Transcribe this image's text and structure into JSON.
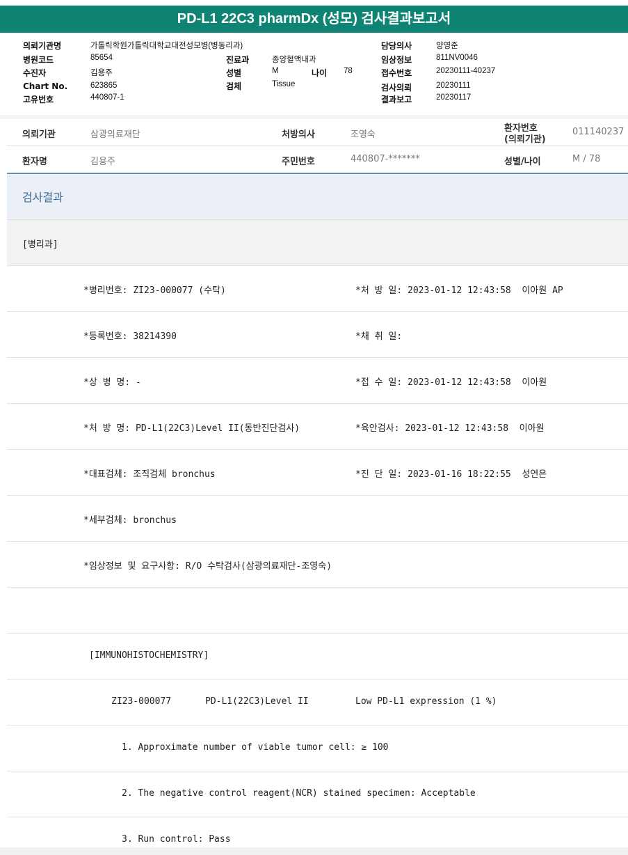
{
  "title": "PD-L1 22C3 pharmDx (성모) 검사결과보고서",
  "header": {
    "referring_org_label": "의뢰기관명",
    "referring_org_value": "가톨릭학원가톨릭대학교대전성모병(병동리과)",
    "hospital_code_label": "병원코드",
    "hospital_code_value": "85654",
    "examinee_label": "수진자",
    "examinee_value": "김용주",
    "chart_no_label": "Chart No.",
    "chart_no_value": "623865",
    "unique_no_label": "고유번호",
    "unique_no_value": "440807-1",
    "dept_label": "진료과",
    "dept_value": "종양혈액내과",
    "sex_label": "성별",
    "sex_value": "M",
    "age_label": "나이",
    "age_value": "78",
    "specimen_label": "검체",
    "specimen_value": "Tissue",
    "doctor_label": "담당의사",
    "doctor_value": "양영준",
    "clinical_label": "임상정보",
    "clinical_value": "811NV0046",
    "receipt_label": "접수번호",
    "receipt_value": "20230111-40237",
    "request_label": "검사의뢰",
    "request_value": "20230111",
    "report_label": "결과보고",
    "report_value": "20230117"
  },
  "patient": {
    "org_label": "의뢰기관",
    "org_value": "삼광의료재단",
    "prescriber_label": "처방의사",
    "prescriber_value": "조영숙",
    "pt_no_label_1": "환자번호",
    "pt_no_label_2": "(의뢰기관)",
    "pt_no_value": "011140237",
    "name_label": "환자명",
    "name_value": "김용주",
    "rrn_label": "주민번호",
    "rrn_value": "440807-*******",
    "sexage_label": "성별/나이",
    "sexage_value": "M / 78"
  },
  "section_title": "검사결과",
  "report": {
    "dept": "[병리과]",
    "path_no": "*병리번호: ZI23-000077 (수탁)",
    "rx_date": "*처 방 일: 2023-01-12 12:43:58  이아원 AP",
    "reg_no": "*등록번호: 38214390",
    "collect_date": "*채 취 일:",
    "disease": "*상 병 명: -",
    "receipt_date": "*접 수 일: 2023-01-12 12:43:58  이아원",
    "rx_name": "*처 방 명: PD-L1(22C3)Level II(동반진단검사)",
    "gross_exam": "*육안검사: 2023-01-12 12:43:58  이아원",
    "rep_specimen": "*대표검체: 조직검체 bronchus",
    "dx_date": "*진 단 일: 2023-01-16 18:22:55  성연은",
    "sub_specimen": "*세부검체: bronchus",
    "clinical_req": "*임상정보 및 요구사항: R/O 수탁검사(삼광의료재단-조영숙)",
    "ihc_title": "[IMMUNOHISTOCHEMISTRY]",
    "ihc_id": "ZI23-000077",
    "ihc_test": "PD-L1(22C3)Level II",
    "ihc_result": "Low PD-L1 expression (1 %)",
    "item1": "1. Approximate number of viable tumor cell: ≥ 100",
    "item2": "2. The negative control reagent(NCR) stained specimen: Acceptable",
    "item3": "3. Run control: Pass"
  }
}
